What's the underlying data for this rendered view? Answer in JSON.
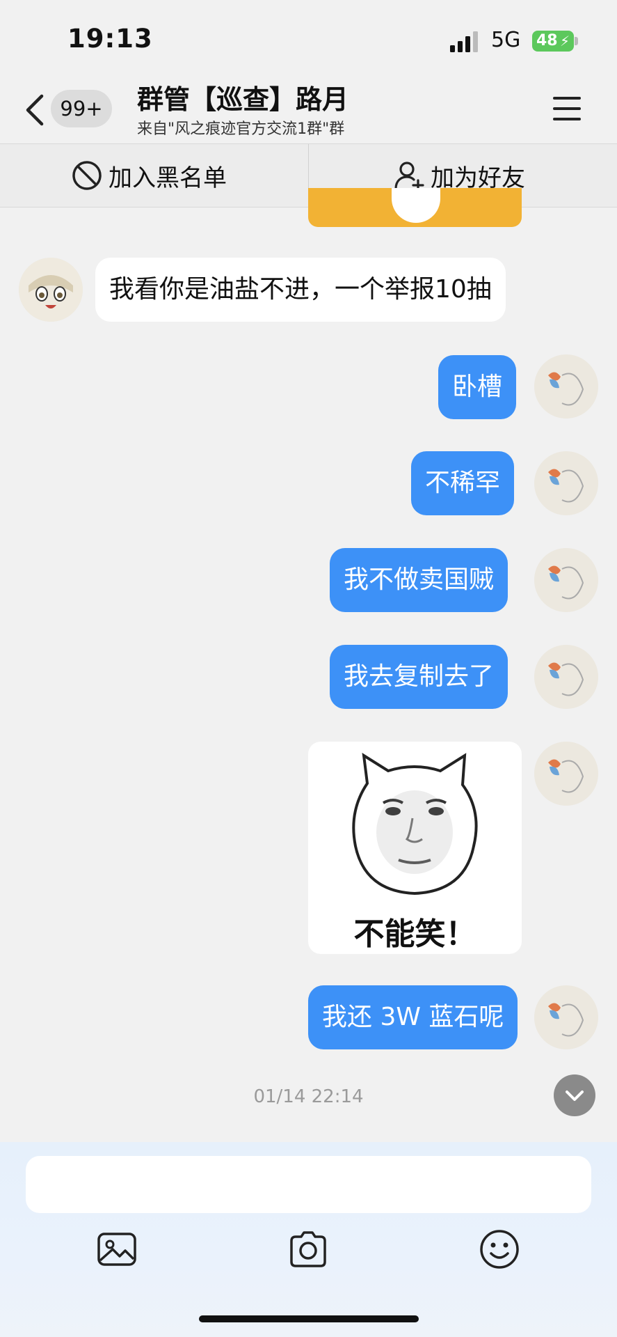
{
  "status_bar": {
    "time": "19:13",
    "network": "5G",
    "battery": "48"
  },
  "header": {
    "unread_badge": "99+",
    "title": "群管【巡查】路月",
    "subtitle": "来自\"风之痕迹官方交流1群\"群"
  },
  "actions": {
    "blacklist": "加入黑名单",
    "add_friend": "加为好友"
  },
  "messages": [
    {
      "side": "in",
      "text": "我看你是油盐不进，一个举报10抽"
    },
    {
      "side": "out",
      "text": "卧槽"
    },
    {
      "side": "out",
      "text": "不稀罕"
    },
    {
      "side": "out",
      "text": "我不做卖国贼"
    },
    {
      "side": "out",
      "text": "我去复制去了"
    },
    {
      "side": "out",
      "sticker_text": "不能笑！"
    },
    {
      "side": "out",
      "text": "我还 3W 蓝石呢"
    }
  ],
  "timestamp": "01/14 22:14",
  "colors": {
    "outgoing_bubble": "#3d91f7",
    "incoming_bubble": "#ffffff",
    "background": "#f1f1f1"
  }
}
